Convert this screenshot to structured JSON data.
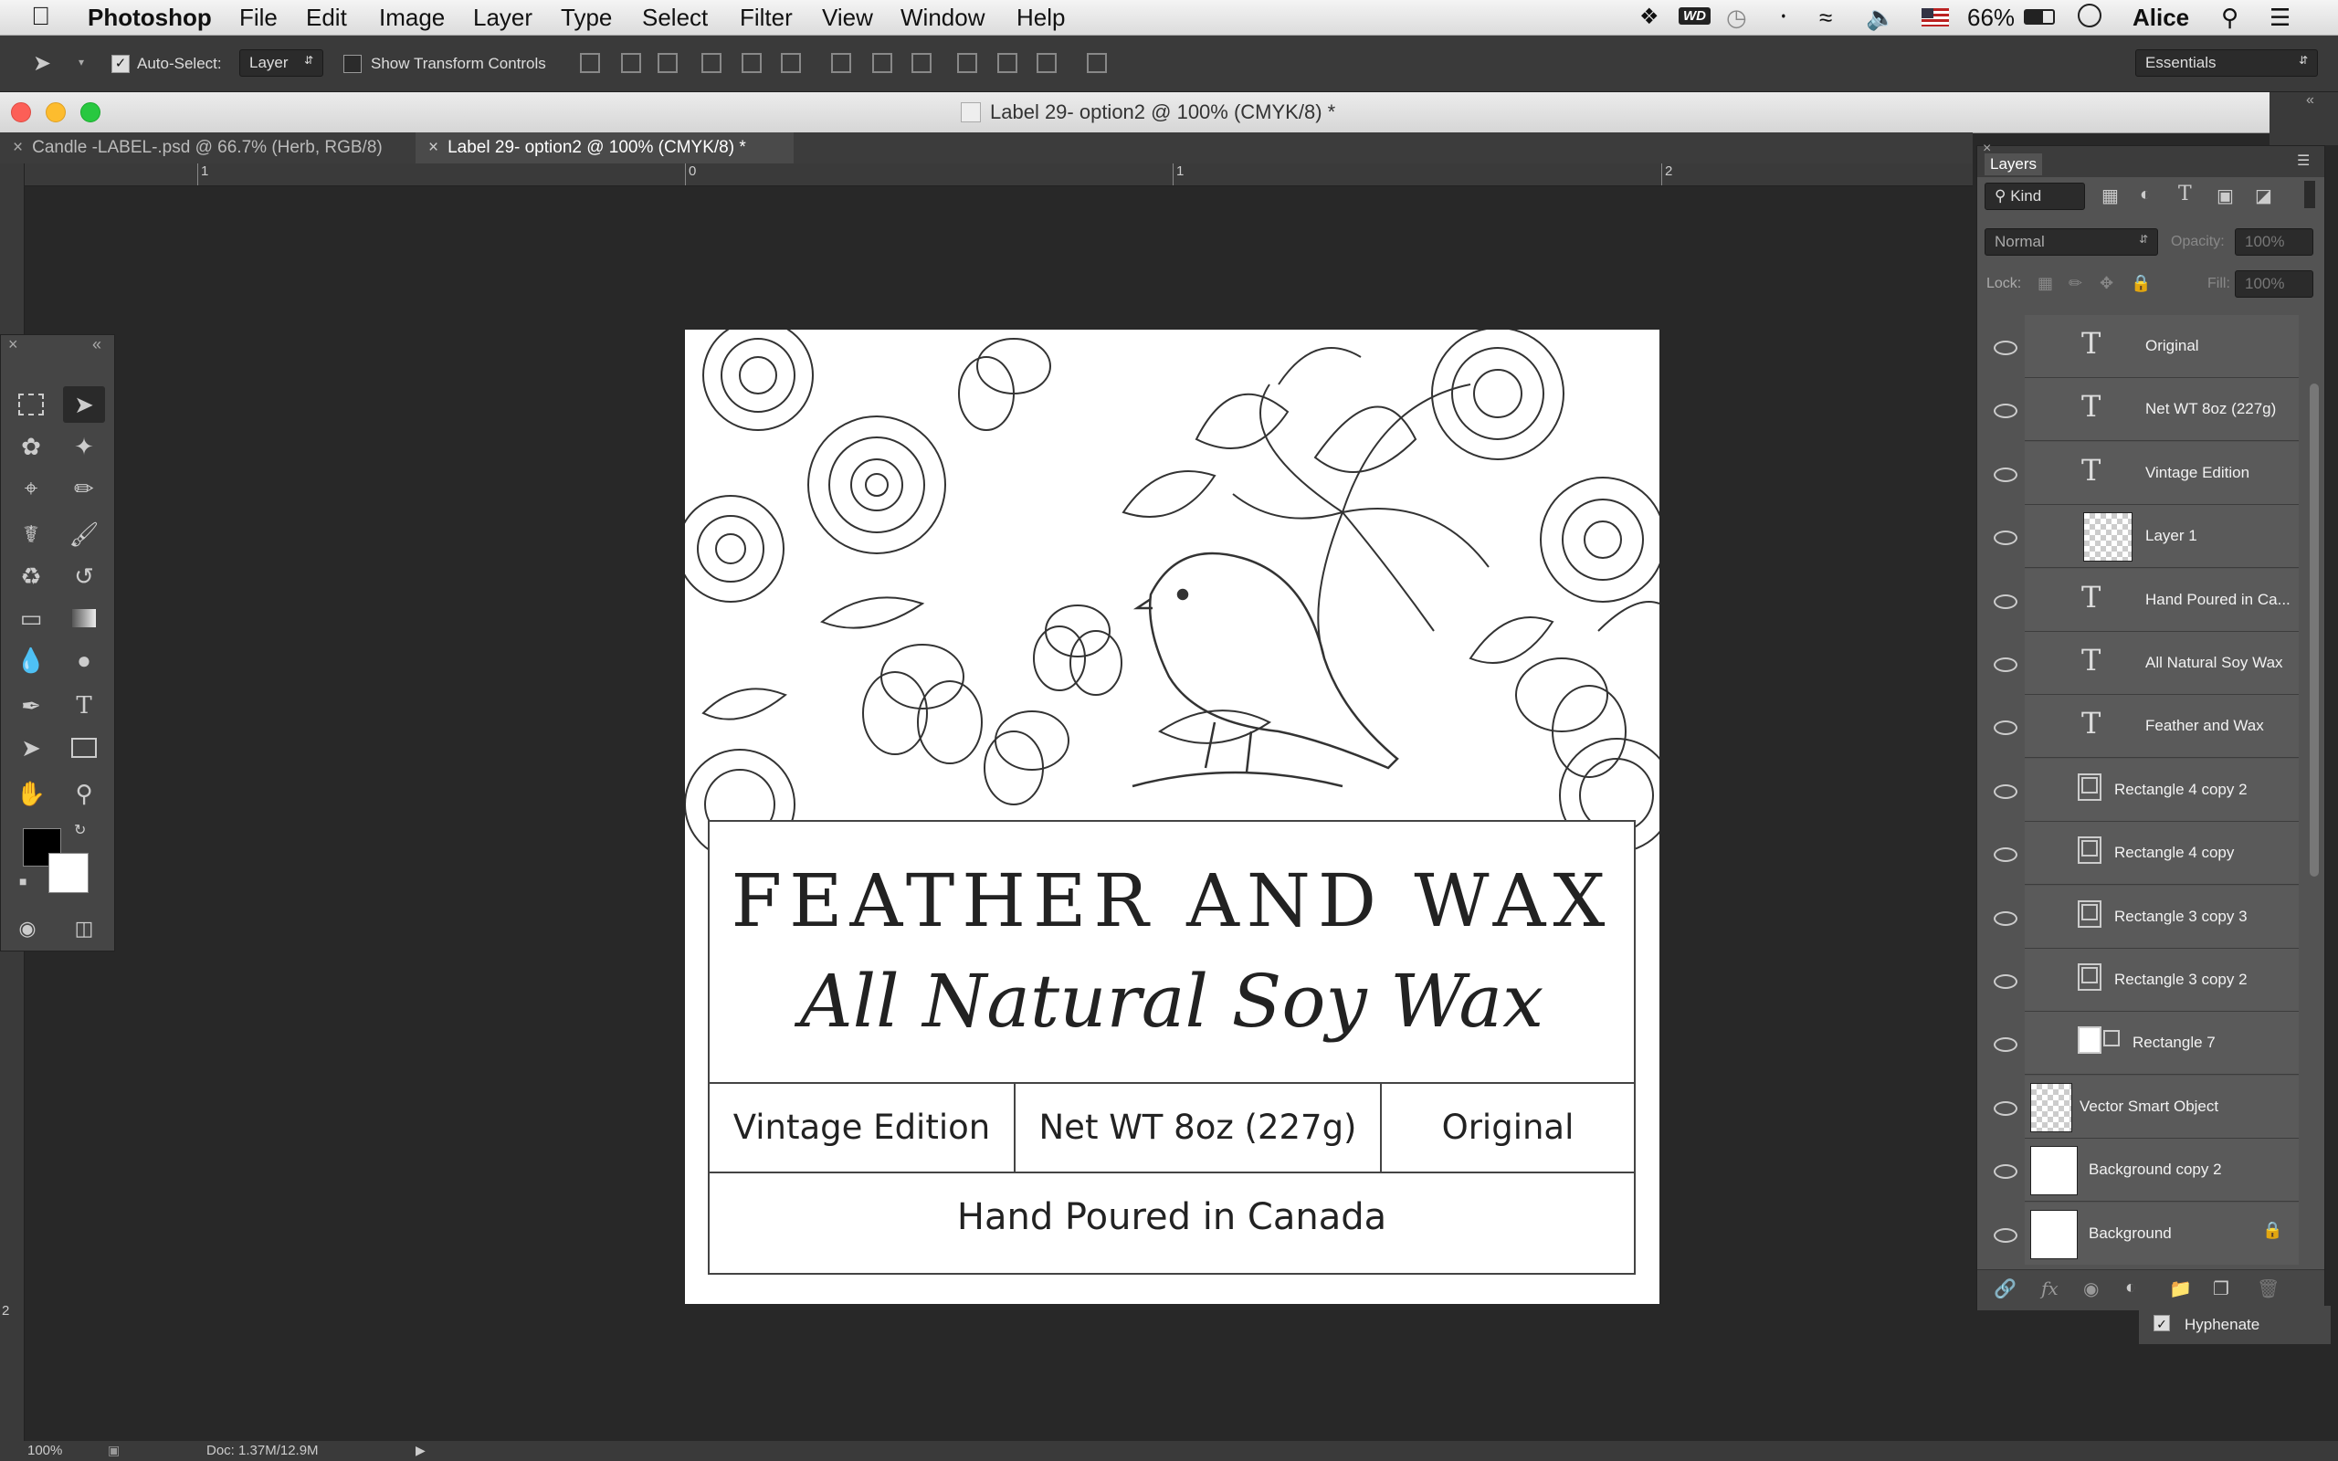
{
  "menubar": {
    "app": "Photoshop",
    "items": [
      "File",
      "Edit",
      "Image",
      "Layer",
      "Type",
      "Select",
      "Filter",
      "View",
      "Window",
      "Help"
    ],
    "battery": "66%",
    "user": "Alice",
    "wd_badge": "WD"
  },
  "options": {
    "auto_select_label": "Auto-Select:",
    "auto_select_value": "Layer",
    "show_transform_label": "Show Transform Controls",
    "workspace": "Essentials"
  },
  "window": {
    "title": "Label 29- option2 @ 100% (CMYK/8) *"
  },
  "tabs": [
    {
      "label": "Candle -LABEL-.psd @ 66.7% (Herb, RGB/8)"
    },
    {
      "label": "Label 29- option2 @ 100% (CMYK/8) *"
    }
  ],
  "rulers": {
    "h_labels": [
      "1",
      "0",
      "1",
      "2"
    ],
    "v_labels": [
      "2"
    ]
  },
  "label": {
    "brand": "FEATHER AND WAX",
    "tagline": "All Natural Soy Wax",
    "col1": "Vintage Edition",
    "col2": "Net WT 8oz (227g)",
    "col3": "Original",
    "footer": "Hand Poured in Canada"
  },
  "layers_panel": {
    "title": "Layers",
    "filter": "Kind",
    "blend": "Normal",
    "opacity_label": "Opacity:",
    "opacity_value": "100%",
    "lock_label": "Lock:",
    "fill_label": "Fill:",
    "fill_value": "100%",
    "layers": [
      {
        "name": "Original",
        "kind": "text"
      },
      {
        "name": "Net WT 8oz (227g)",
        "kind": "text"
      },
      {
        "name": "Vintage Edition",
        "kind": "text"
      },
      {
        "name": "Layer 1",
        "kind": "pixel"
      },
      {
        "name": "Hand Poured in Ca...",
        "kind": "text"
      },
      {
        "name": "All Natural Soy Wax",
        "kind": "text"
      },
      {
        "name": "Feather and Wax",
        "kind": "text"
      },
      {
        "name": "Rectangle 4 copy 2",
        "kind": "shape"
      },
      {
        "name": "Rectangle 4 copy",
        "kind": "shape"
      },
      {
        "name": "Rectangle 3 copy 3",
        "kind": "shape"
      },
      {
        "name": "Rectangle 3 copy 2",
        "kind": "shape"
      },
      {
        "name": "Rectangle 7",
        "kind": "shape-white"
      },
      {
        "name": "Vector Smart Object",
        "kind": "smart"
      },
      {
        "name": "Background copy 2",
        "kind": "white"
      },
      {
        "name": "Background",
        "kind": "white-locked"
      }
    ]
  },
  "hyphenate": "Hyphenate",
  "status": {
    "zoom": "100%",
    "doc": "Doc: 1.37M/12.9M"
  }
}
